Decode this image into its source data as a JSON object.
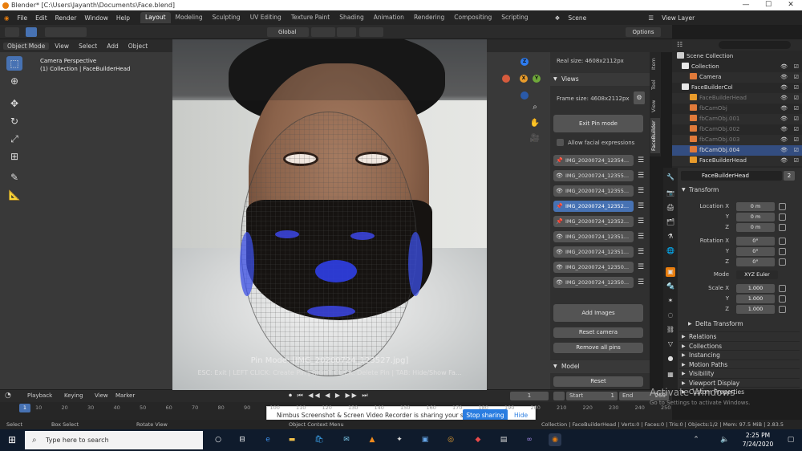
{
  "window": {
    "title": "Blender* [C:\\Users\\Jayanth\\Documents\\Face.blend]",
    "min": "—",
    "max": "☐",
    "close": "✕"
  },
  "menu": [
    "File",
    "Edit",
    "Render",
    "Window",
    "Help"
  ],
  "workspace_tabs": [
    "Layout",
    "Modeling",
    "Sculpting",
    "UV Editing",
    "Texture Paint",
    "Shading",
    "Animation",
    "Rendering",
    "Compositing",
    "Scripting"
  ],
  "scene": {
    "label": "Scene",
    "view_layer": "View Layer"
  },
  "toolbar": {
    "orientation": "Global",
    "options": "Options"
  },
  "header": {
    "mode": "Object Mode",
    "items": [
      "View",
      "Select",
      "Add",
      "Object"
    ]
  },
  "viewport": {
    "camera_title": "Camera Perspective",
    "camera_sub": "(1) Collection | FaceBuilderHead",
    "pin_mode": "Pin Mode: [IMG_20200724_123527.jpg]",
    "hint": "ESC: Exit | LEFT CLICK: Create Pin | RIGHT CLICK: Delete Pin | TAB: Hide/Show Fa..."
  },
  "gizmo": {
    "x": "X",
    "y": "Y",
    "z": "Z"
  },
  "npanel": {
    "real_size": "Real size: 4608x2112px",
    "views_title": "Views",
    "frame_size": "Frame size: 4608x2112px",
    "exit_pin": "Exit Pin mode",
    "allow_facial": "Allow facial expressions",
    "images": [
      {
        "name": "IMG_20200724_12354...",
        "selected": false
      },
      {
        "name": "IMG_20200724_12355...",
        "selected": false
      },
      {
        "name": "IMG_20200724_12355...",
        "selected": false
      },
      {
        "name": "IMG_20200724_12352...",
        "selected": true
      },
      {
        "name": "IMG_20200724_12352...",
        "selected": false
      },
      {
        "name": "IMG_20200724_12351...",
        "selected": false
      },
      {
        "name": "IMG_20200724_12351...",
        "selected": false
      },
      {
        "name": "IMG_20200724_12350...",
        "selected": false
      },
      {
        "name": "IMG_20200724_12350...",
        "selected": false
      }
    ],
    "add_images": "Add Images",
    "reset_camera": "Reset camera",
    "remove_pins": "Remove all pins",
    "model_title": "Model",
    "reset": "Reset"
  },
  "side_tabs": [
    "Item",
    "Tool",
    "View",
    "FaceBuilder"
  ],
  "outliner": {
    "title": "Scene Collection",
    "rows": [
      {
        "name": "Collection",
        "kind": "coll",
        "dim": false,
        "sel": false
      },
      {
        "name": "Camera",
        "kind": "cam",
        "dim": false,
        "sel": false
      },
      {
        "name": "FaceBuilderCol",
        "kind": "coll",
        "dim": false,
        "sel": false
      },
      {
        "name": "FaceBuilderHead",
        "kind": "mesh",
        "dim": true,
        "sel": false
      },
      {
        "name": "fbCamObj",
        "kind": "cam",
        "dim": true,
        "sel": false
      },
      {
        "name": "fbCamObj.001",
        "kind": "cam",
        "dim": true,
        "sel": false
      },
      {
        "name": "fbCamObj.002",
        "kind": "cam",
        "dim": true,
        "sel": false
      },
      {
        "name": "fbCamObj.003",
        "kind": "cam",
        "dim": true,
        "sel": false
      },
      {
        "name": "fbCamObj.004",
        "kind": "cam",
        "dim": false,
        "sel": true
      },
      {
        "name": "FaceBuilderHead",
        "kind": "mesh",
        "dim": false,
        "sel": false
      }
    ]
  },
  "properties": {
    "object_name": "FaceBuilderHead",
    "users": "2",
    "transform": "Transform",
    "location_label": "Location X",
    "location": [
      "0 m",
      "0 m",
      "0 m"
    ],
    "rotation_label": "Rotation X",
    "rotation": [
      "0°",
      "0°",
      "0°"
    ],
    "mode_label": "Mode",
    "mode_value": "XYZ Euler",
    "scale_label": "Scale X",
    "scale": [
      "1.000",
      "1.000",
      "1.000"
    ],
    "y": "Y",
    "z": "Z",
    "delta": "Delta Transform",
    "sections": [
      "Relations",
      "Collections",
      "Instancing",
      "Motion Paths",
      "Visibility",
      "Viewport Display",
      "Custom Properties"
    ]
  },
  "timeline": {
    "menus": [
      "Playback",
      "Keying",
      "View",
      "Marker"
    ],
    "current": "1",
    "start_label": "Start",
    "start": "1",
    "end_label": "End",
    "end": "250",
    "ticks": [
      "1",
      "10",
      "20",
      "30",
      "40",
      "50",
      "60",
      "70",
      "80",
      "90",
      "100",
      "110",
      "120",
      "130",
      "140",
      "150",
      "160",
      "170",
      "180",
      "190",
      "200",
      "210",
      "220",
      "230",
      "240",
      "250"
    ]
  },
  "nimbus": {
    "text": "Nimbus Screenshot & Screen Video Recorder is sharing your screen.",
    "stop": "Stop sharing",
    "hide": "Hide"
  },
  "status": {
    "left": [
      "Select",
      "Box Select",
      "Rotate View",
      "Object Context Menu"
    ],
    "right": "Collection | FaceBuilderHead | Verts:0 | Faces:0 | Tris:0 | Objects:1/2 | Mem: 97.5 MiB | 2.83.5"
  },
  "watermark": {
    "line1": "Activate Windows",
    "line2": "Go to Settings to activate Windows."
  },
  "taskbar": {
    "search_placeholder": "Type here to search",
    "time": "2:25 PM",
    "date": "7/24/2020"
  },
  "colors": {
    "accent": "#4772b3",
    "orange": "#e87d0d"
  }
}
